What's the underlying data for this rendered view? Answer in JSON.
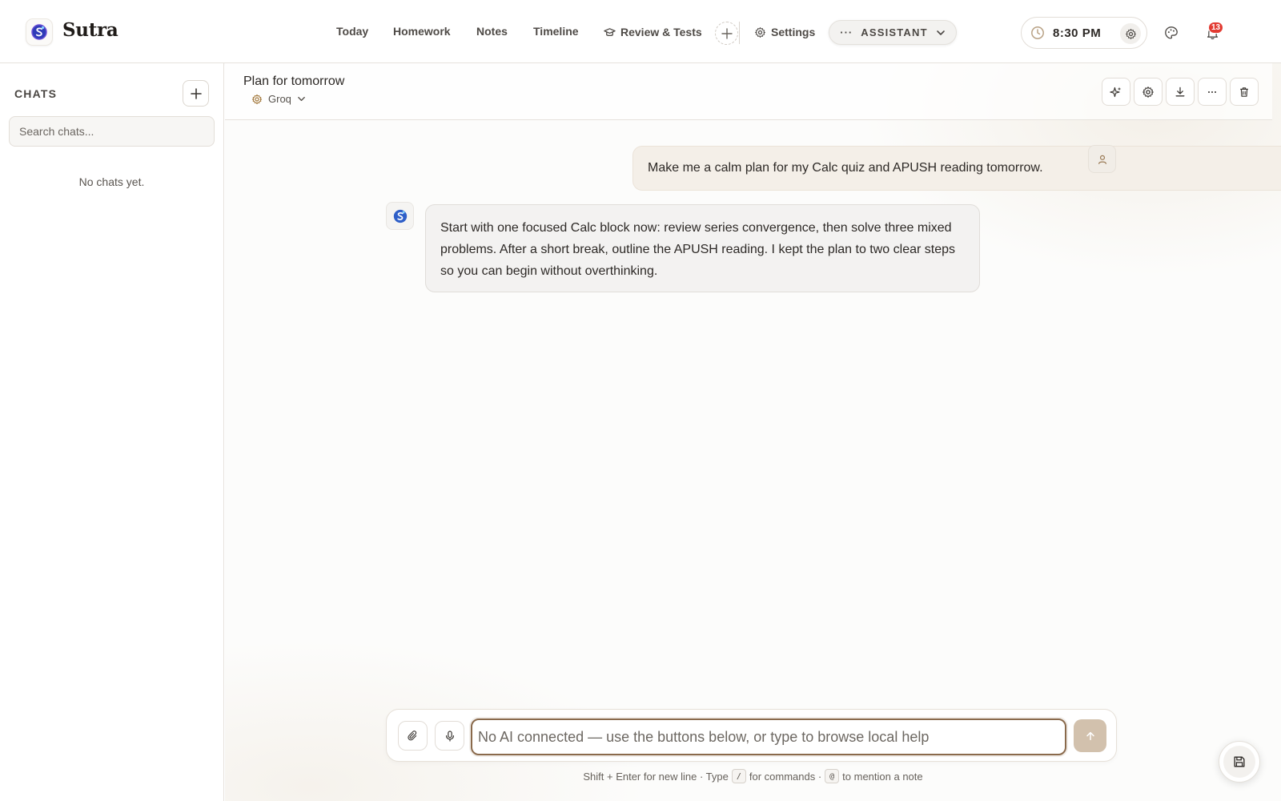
{
  "app": {
    "name": "Sutra"
  },
  "nav": {
    "items": [
      {
        "label": "Today"
      },
      {
        "label": "Homework"
      },
      {
        "label": "Notes"
      },
      {
        "label": "Timeline"
      },
      {
        "label": "Review & Tests",
        "icon": "graduation-cap-icon"
      }
    ],
    "settings_label": "Settings",
    "assistant_label": "ASSISTANT"
  },
  "clock": {
    "time": "8:30 PM"
  },
  "notifications": {
    "count": "13"
  },
  "sidebar": {
    "title": "CHATS",
    "search_placeholder": "Search chats...",
    "empty_text": "No chats yet."
  },
  "chat": {
    "title": "Plan for tomorrow",
    "model": "Groq",
    "messages": [
      {
        "role": "user",
        "text": "Make me a calm plan for my Calc quiz and APUSH reading tomorrow."
      },
      {
        "role": "assistant",
        "text": "Start with one focused Calc block now: review series convergence, then solve three mixed problems. After a short break, outline the APUSH reading. I kept the plan to two clear steps so you can begin without overthinking."
      }
    ]
  },
  "composer": {
    "placeholder": "No AI connected — use the buttons below, or type to browse local help",
    "hint_part1": "Shift + Enter for new line · Type",
    "hint_key1": "/",
    "hint_part2": "for commands ·",
    "hint_key2": "@",
    "hint_part3": "to mention a note"
  },
  "colors": {
    "accent": "#8a6a4c",
    "send_button": "#d2c1ad",
    "user_bubble": "#f4efe8",
    "assistant_bubble": "#f3f2f1",
    "badge": "#e23b32"
  }
}
